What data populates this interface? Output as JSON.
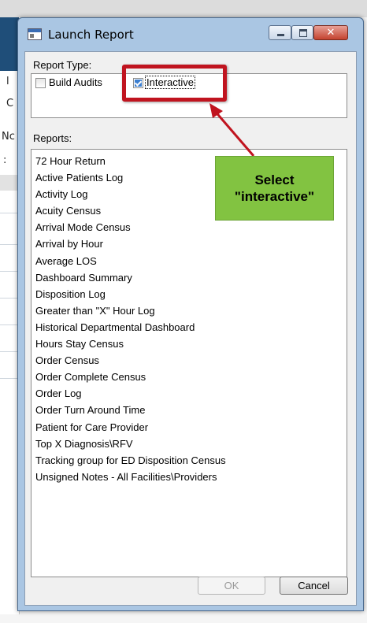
{
  "background": {
    "fragments": [
      "l",
      "C",
      "Nc",
      ":"
    ]
  },
  "dialog": {
    "title": "Launch Report",
    "close_glyph": "✕",
    "report_type_label": "Report Type:",
    "checkboxes": [
      {
        "label": "Build Audits",
        "checked": false
      },
      {
        "label": "Interactive",
        "checked": true
      }
    ],
    "reports_label": "Reports:",
    "reports": [
      "72 Hour Return",
      "Active Patients Log",
      "Activity Log",
      "Acuity Census",
      "Arrival Mode Census",
      "Arrival by Hour",
      "Average LOS",
      "Dashboard Summary",
      "Disposition Log",
      "Greater than \"X\" Hour Log",
      "Historical Departmental Dashboard",
      "Hours Stay Census",
      "Order Census",
      "Order Complete Census",
      "Order Log",
      "Order Turn Around Time",
      "Patient for Care Provider",
      "Top X Diagnosis\\RFV",
      "Tracking group for ED Disposition Census",
      "Unsigned Notes - All Facilities\\Providers"
    ],
    "ok_label": "OK",
    "cancel_label": "Cancel"
  },
  "annotation": {
    "text": "Select\n\"interactive\"",
    "highlight_color": "#c0141f",
    "label_color": "#82c341"
  }
}
